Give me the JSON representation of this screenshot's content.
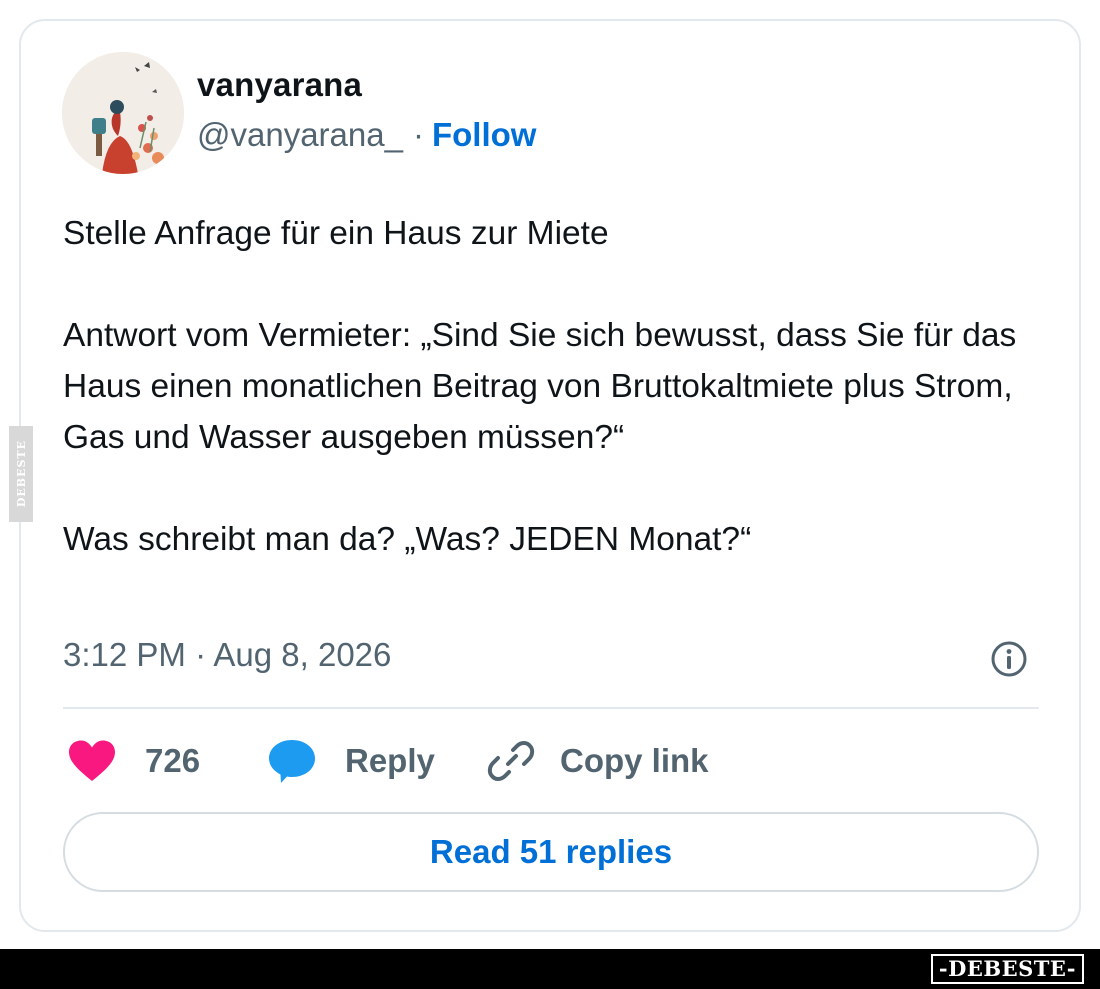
{
  "author": {
    "display_name": "vanyarana",
    "handle": "@vanyarana_",
    "separator": "·",
    "follow_label": "Follow"
  },
  "tweet": {
    "paragraphs": [
      "Stelle Anfrage für ein Haus zur Miete",
      "Antwort vom Vermieter: „Sind Sie sich bewusst, dass Sie für das Haus einen monatlichen Beitrag von Bruttokaltmiete plus Strom, Gas und Wasser ausgeben müssen?“",
      "Was schreibt man da? „Was? JEDEN Monat?“"
    ],
    "timestamp": "3:12 PM · Aug 8, 2026"
  },
  "actions": {
    "like_count": "726",
    "reply_label": "Reply",
    "copy_label": "Copy link"
  },
  "read_replies_label": "Read 51 replies",
  "watermark": {
    "side": "DEBESTE",
    "footer": "-DEBESTE-"
  },
  "colors": {
    "link_blue": "#006fd6",
    "heart_pink": "#f91880",
    "reply_blue": "#1d9bf0",
    "muted": "#536471"
  },
  "icons": [
    "heart-icon",
    "speech-bubble-icon",
    "link-icon",
    "info-icon"
  ]
}
